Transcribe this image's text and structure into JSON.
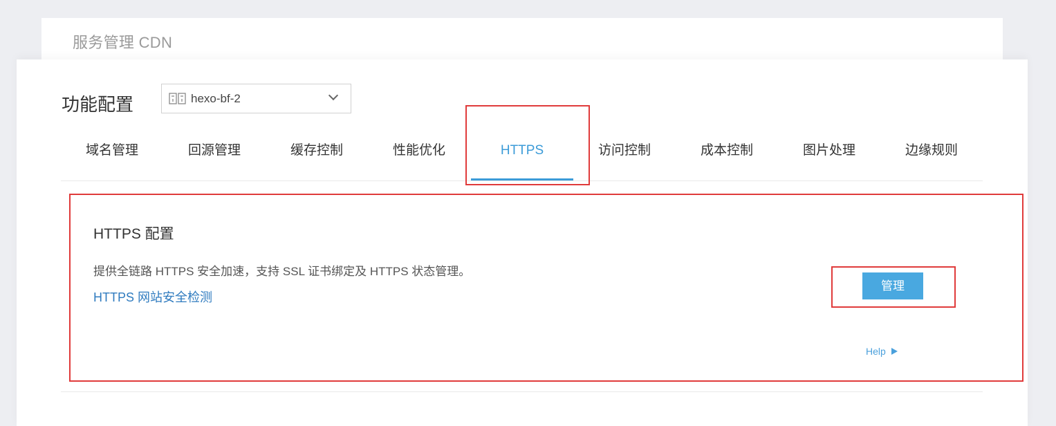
{
  "header": {
    "title": "服务管理 CDN"
  },
  "feature": {
    "title": "功能配置",
    "domain_select": {
      "value": "hexo-bf-2",
      "icon": "domain-icon"
    }
  },
  "tabs": [
    {
      "label": "域名管理"
    },
    {
      "label": "回源管理"
    },
    {
      "label": "缓存控制"
    },
    {
      "label": "性能优化"
    },
    {
      "label": "HTTPS",
      "active": true
    },
    {
      "label": "访问控制"
    },
    {
      "label": "成本控制"
    },
    {
      "label": "图片处理"
    },
    {
      "label": "边缘规则"
    }
  ],
  "panel": {
    "title": "HTTPS 配置",
    "description": "提供全链路 HTTPS 安全加速，支持 SSL 证书绑定及 HTTPS 状态管理。",
    "link": "HTTPS 网站安全检测",
    "manage_button": "管理",
    "help": "Help"
  },
  "colors": {
    "accent": "#3b9bd8",
    "button": "#49a8e0",
    "highlight_border": "#e03a3a",
    "link": "#2f7bbf"
  }
}
